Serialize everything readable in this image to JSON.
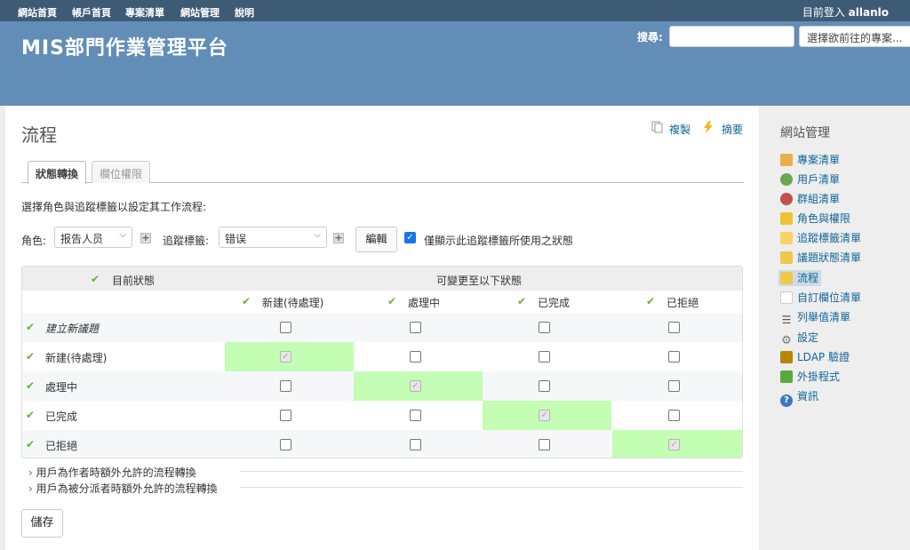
{
  "top_menu": {
    "items": [
      "網站首頁",
      "帳戶首頁",
      "專案清單",
      "網站管理",
      "說明"
    ],
    "logged_as_prefix": "目前登入",
    "logged_as_user": "allanlo"
  },
  "header": {
    "site_title": "MIS部門作業管理平台",
    "search_label": "搜尋:",
    "search_value": "",
    "project_jump": "選擇欲前往的專案..."
  },
  "page": {
    "title": "流程",
    "copy_label": "複製",
    "summary_label": "摘要",
    "tabs": [
      {
        "label": "狀態轉換",
        "active": true
      },
      {
        "label": "欄位權限",
        "active": false
      }
    ],
    "instruction": "選擇角色與追蹤標籤以設定其工作流程:",
    "role_label": "角色:",
    "role_value": "报告人员",
    "tracker_label": "追蹤標籤:",
    "tracker_value": "错误",
    "edit_button": "編輯",
    "used_statuses_only": {
      "label": "僅顯示此追蹤標籤所使用之狀態",
      "checked": true
    }
  },
  "transitions": {
    "current_status_header": "目前狀態",
    "new_status_header": "可變更至以下狀態",
    "columns": [
      "新建(待處理)",
      "處理中",
      "已完成",
      "已拒絕"
    ],
    "rows": [
      {
        "label": "建立新議題",
        "italic": true,
        "checks": [
          false,
          false,
          false,
          false
        ]
      },
      {
        "label": "新建(待處理)",
        "italic": false,
        "checks": [
          true,
          false,
          false,
          false
        ]
      },
      {
        "label": "處理中",
        "italic": false,
        "checks": [
          false,
          true,
          false,
          false
        ]
      },
      {
        "label": "已完成",
        "italic": false,
        "checks": [
          false,
          false,
          true,
          false
        ]
      },
      {
        "label": "已拒絕",
        "italic": false,
        "checks": [
          false,
          false,
          false,
          true
        ]
      }
    ],
    "highlight_color": "#c4fdb4",
    "check_color": "#67b13b"
  },
  "fieldsets": [
    "用戶為作者時額外允許的流程轉換",
    "用戶為被分派者時額外允許的流程轉換"
  ],
  "save_button": "儲存",
  "sidebar": {
    "title": "網站管理",
    "items": [
      {
        "label": "專案清單",
        "icon": "projects-icon"
      },
      {
        "label": "用戶清單",
        "icon": "user-icon"
      },
      {
        "label": "群組清單",
        "icon": "group-icon"
      },
      {
        "label": "角色與權限",
        "icon": "roles-icon"
      },
      {
        "label": "追蹤標籤清單",
        "icon": "trackers-icon"
      },
      {
        "label": "議題狀態清單",
        "icon": "issue-status-icon"
      },
      {
        "label": "流程",
        "icon": "workflow-icon",
        "selected": true
      },
      {
        "label": "自訂欄位清單",
        "icon": "custom-fields-icon"
      },
      {
        "label": "列舉值清單",
        "icon": "list-icon"
      },
      {
        "label": "設定",
        "icon": "settings-icon"
      },
      {
        "label": "LDAP 驗證",
        "icon": "ldap-icon"
      },
      {
        "label": "外掛程式",
        "icon": "plugin-icon"
      },
      {
        "label": "資訊",
        "icon": "info-icon"
      }
    ]
  }
}
